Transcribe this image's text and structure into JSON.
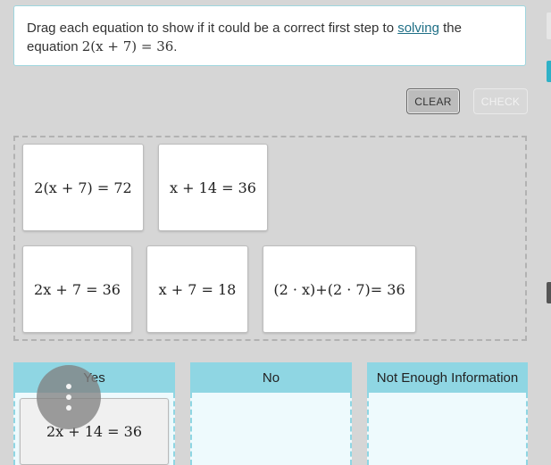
{
  "prompt": {
    "text_before": "Drag each equation to show if it could be a correct first step to ",
    "link": "solving",
    "text_after": " the equation ",
    "equation": "2(x + 7) = 36",
    "period": "."
  },
  "toolbar": {
    "clear_label": "CLEAR",
    "check_label": "CHECK"
  },
  "tray": {
    "tiles": [
      "2(x + 7) = 72",
      "x + 14 = 36",
      "2x + 7 = 36",
      "x + 7 = 18",
      "(2 · x)+(2 · 7)= 36"
    ]
  },
  "columns": [
    {
      "header": "Yes",
      "placed": [
        "2x + 14 = 36"
      ]
    },
    {
      "header": "No",
      "placed": []
    },
    {
      "header": "Not Enough Information",
      "placed": []
    }
  ],
  "overlay": {
    "icon": "vertical-ellipsis-icon"
  },
  "colors": {
    "accent": "#8fd6e3",
    "link": "#1f6f86",
    "edge_tab_teal": "#2fb1c7",
    "edge_tab_dark": "#555555"
  }
}
